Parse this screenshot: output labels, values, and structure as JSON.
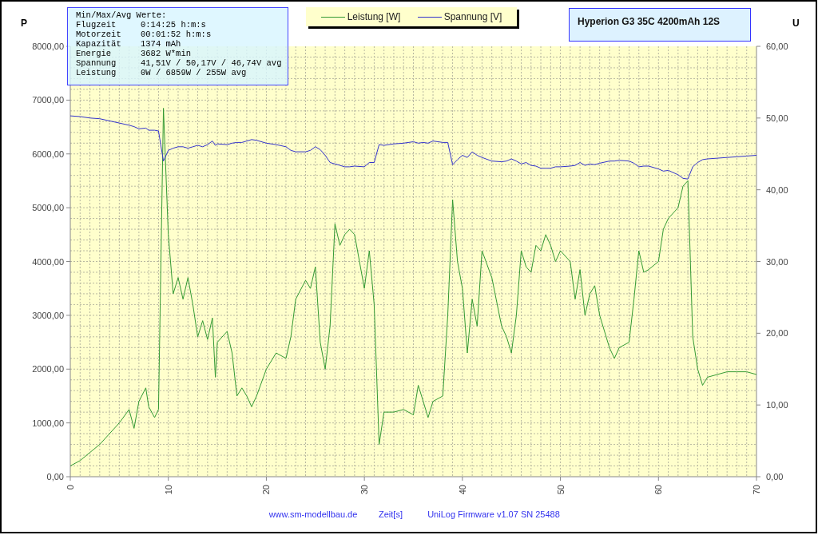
{
  "stats": {
    "title": "Min/Max/Avg Werte:",
    "rows": [
      {
        "label": "Flugzeit",
        "value": "0:14:25 h:m:s"
      },
      {
        "label": "Motorzeit",
        "value": "00:01:52 h:m:s"
      },
      {
        "label": "Kapazität",
        "value": "1374 mAh"
      },
      {
        "label": "Energie",
        "value": "3682 W*min"
      },
      {
        "label": "Spannung",
        "value": "41,51V / 50,17V / 46,74V avg"
      },
      {
        "label": "Leistung",
        "value": "0W / 6859W / 255W avg"
      }
    ]
  },
  "battery_title": "Hyperion G3 35C 4200mAh 12S",
  "chart_data": {
    "type": "line",
    "grid": true,
    "xlabel": "Zeit[s]",
    "ylabel": "P",
    "y2label": "U",
    "xlim": [
      0,
      70
    ],
    "ylim": [
      0,
      8000
    ],
    "y2lim": [
      0,
      60
    ],
    "xticks": [
      0,
      10,
      20,
      30,
      40,
      50,
      60,
      70
    ],
    "yticks": [
      {
        "value": 0,
        "label": "0,00"
      },
      {
        "value": 1000,
        "label": "1000,00"
      },
      {
        "value": 2000,
        "label": "2000,00"
      },
      {
        "value": 3000,
        "label": "3000,00"
      },
      {
        "value": 4000,
        "label": "4000,00"
      },
      {
        "value": 5000,
        "label": "5000,00"
      },
      {
        "value": 6000,
        "label": "6000,00"
      },
      {
        "value": 7000,
        "label": "7000,00"
      },
      {
        "value": 8000,
        "label": "8000,00"
      }
    ],
    "y2ticks": [
      {
        "value": 0,
        "label": "0,00"
      },
      {
        "value": 10,
        "label": "10,00"
      },
      {
        "value": 20,
        "label": "20,00"
      },
      {
        "value": 30,
        "label": "30,00"
      },
      {
        "value": 40,
        "label": "40,00"
      },
      {
        "value": 50,
        "label": "50,00"
      },
      {
        "value": 60,
        "label": "60,00"
      }
    ],
    "x": [
      0,
      1,
      2,
      3,
      4,
      5,
      6,
      6.5,
      7,
      7.7,
      8,
      8.6,
      9,
      9.5,
      10,
      10.5,
      11,
      11.5,
      12,
      12.5,
      13,
      13.5,
      14,
      14.5,
      14.8,
      15,
      16,
      16.5,
      17,
      17.5,
      18,
      18.5,
      19,
      20,
      21,
      22,
      22.5,
      23,
      24,
      24.5,
      25,
      25.5,
      26,
      26.5,
      27,
      27.5,
      28,
      28.5,
      29,
      30,
      30.5,
      31,
      31.5,
      32,
      33,
      34,
      35,
      35.5,
      36,
      36.5,
      37,
      38,
      38.5,
      39,
      39.5,
      40,
      40.5,
      41,
      41.5,
      42,
      43,
      44,
      44.5,
      45,
      45.5,
      46,
      46.5,
      47,
      47.5,
      48,
      48.5,
      49,
      49.5,
      50,
      51,
      51.5,
      52,
      52.5,
      53,
      53.5,
      54,
      55,
      55.5,
      56,
      57,
      57.5,
      58,
      58.5,
      59,
      60,
      60.5,
      61,
      62,
      62.5,
      63,
      63.5,
      64,
      64.5,
      65,
      66,
      67,
      68,
      69,
      70
    ],
    "series": [
      {
        "name": "Leistung [W]",
        "color": "#339933",
        "values": [
          200,
          300,
          450,
          600,
          800,
          1000,
          1250,
          900,
          1400,
          1650,
          1300,
          1100,
          1250,
          6850,
          4500,
          3400,
          3700,
          3300,
          3700,
          3200,
          2600,
          2900,
          2550,
          2950,
          1850,
          2500,
          2700,
          2300,
          1500,
          1650,
          1500,
          1300,
          1500,
          2000,
          2300,
          2200,
          2600,
          3300,
          3650,
          3500,
          3900,
          2500,
          2000,
          2800,
          4700,
          4300,
          4500,
          4600,
          4500,
          3500,
          4200,
          3200,
          600,
          1200,
          1200,
          1250,
          1150,
          1700,
          1400,
          1100,
          1400,
          1500,
          3000,
          5150,
          4000,
          3500,
          2300,
          3300,
          2800,
          4200,
          3700,
          2800,
          2600,
          2300,
          3000,
          4200,
          3900,
          3800,
          4300,
          4200,
          4500,
          4300,
          4000,
          4200,
          4000,
          3300,
          3850,
          3000,
          3400,
          3550,
          3000,
          2400,
          2200,
          2400,
          2500,
          3300,
          4200,
          3800,
          3850,
          4000,
          4600,
          4800,
          5000,
          5400,
          5500,
          2600,
          2000,
          1700,
          1850,
          1900,
          1950,
          1950,
          1950,
          1900
        ]
      },
      {
        "name": "Spannung [V]",
        "color": "#3333cc",
        "axis": "y2",
        "values": [
          50.3,
          50.2,
          50,
          49.9,
          49.6,
          49.3,
          49,
          48.8,
          48.5,
          48.6,
          48.3,
          48.3,
          48.2,
          44,
          45.5,
          45.8,
          46,
          46,
          45.8,
          46,
          46.2,
          46,
          46.3,
          46.8,
          46.2,
          46.4,
          46.3,
          46.5,
          46.6,
          46.6,
          46.8,
          47,
          46.9,
          46.5,
          46.3,
          46,
          45.5,
          45.3,
          45.3,
          45.5,
          46,
          45.6,
          44.8,
          43.8,
          43.6,
          43.4,
          43.2,
          43.2,
          43.3,
          43.2,
          43.8,
          43.8,
          46.3,
          46.2,
          46.4,
          46.5,
          46.7,
          46.5,
          46.6,
          46.5,
          46.8,
          46.6,
          46.6,
          43.5,
          44.2,
          44.8,
          44.5,
          45.3,
          44.8,
          44.5,
          44,
          43.9,
          44,
          44.3,
          44,
          43.6,
          43.8,
          43.4,
          43.3,
          43,
          43,
          43,
          43.2,
          43.2,
          43.3,
          43.4,
          43.8,
          43.4,
          43.6,
          43.5,
          43.7,
          44,
          44,
          44.1,
          44,
          43.7,
          43.2,
          43.3,
          43.3,
          42.9,
          42.6,
          42.7,
          42.1,
          41.6,
          41.5,
          43.2,
          43.8,
          44.2,
          44.3,
          44.4,
          44.5,
          44.6,
          44.7,
          44.8
        ]
      }
    ]
  },
  "footer": {
    "website": "www.sm-modellbau.de",
    "firmware": "UniLog Firmware v1.07 SN 25488"
  }
}
